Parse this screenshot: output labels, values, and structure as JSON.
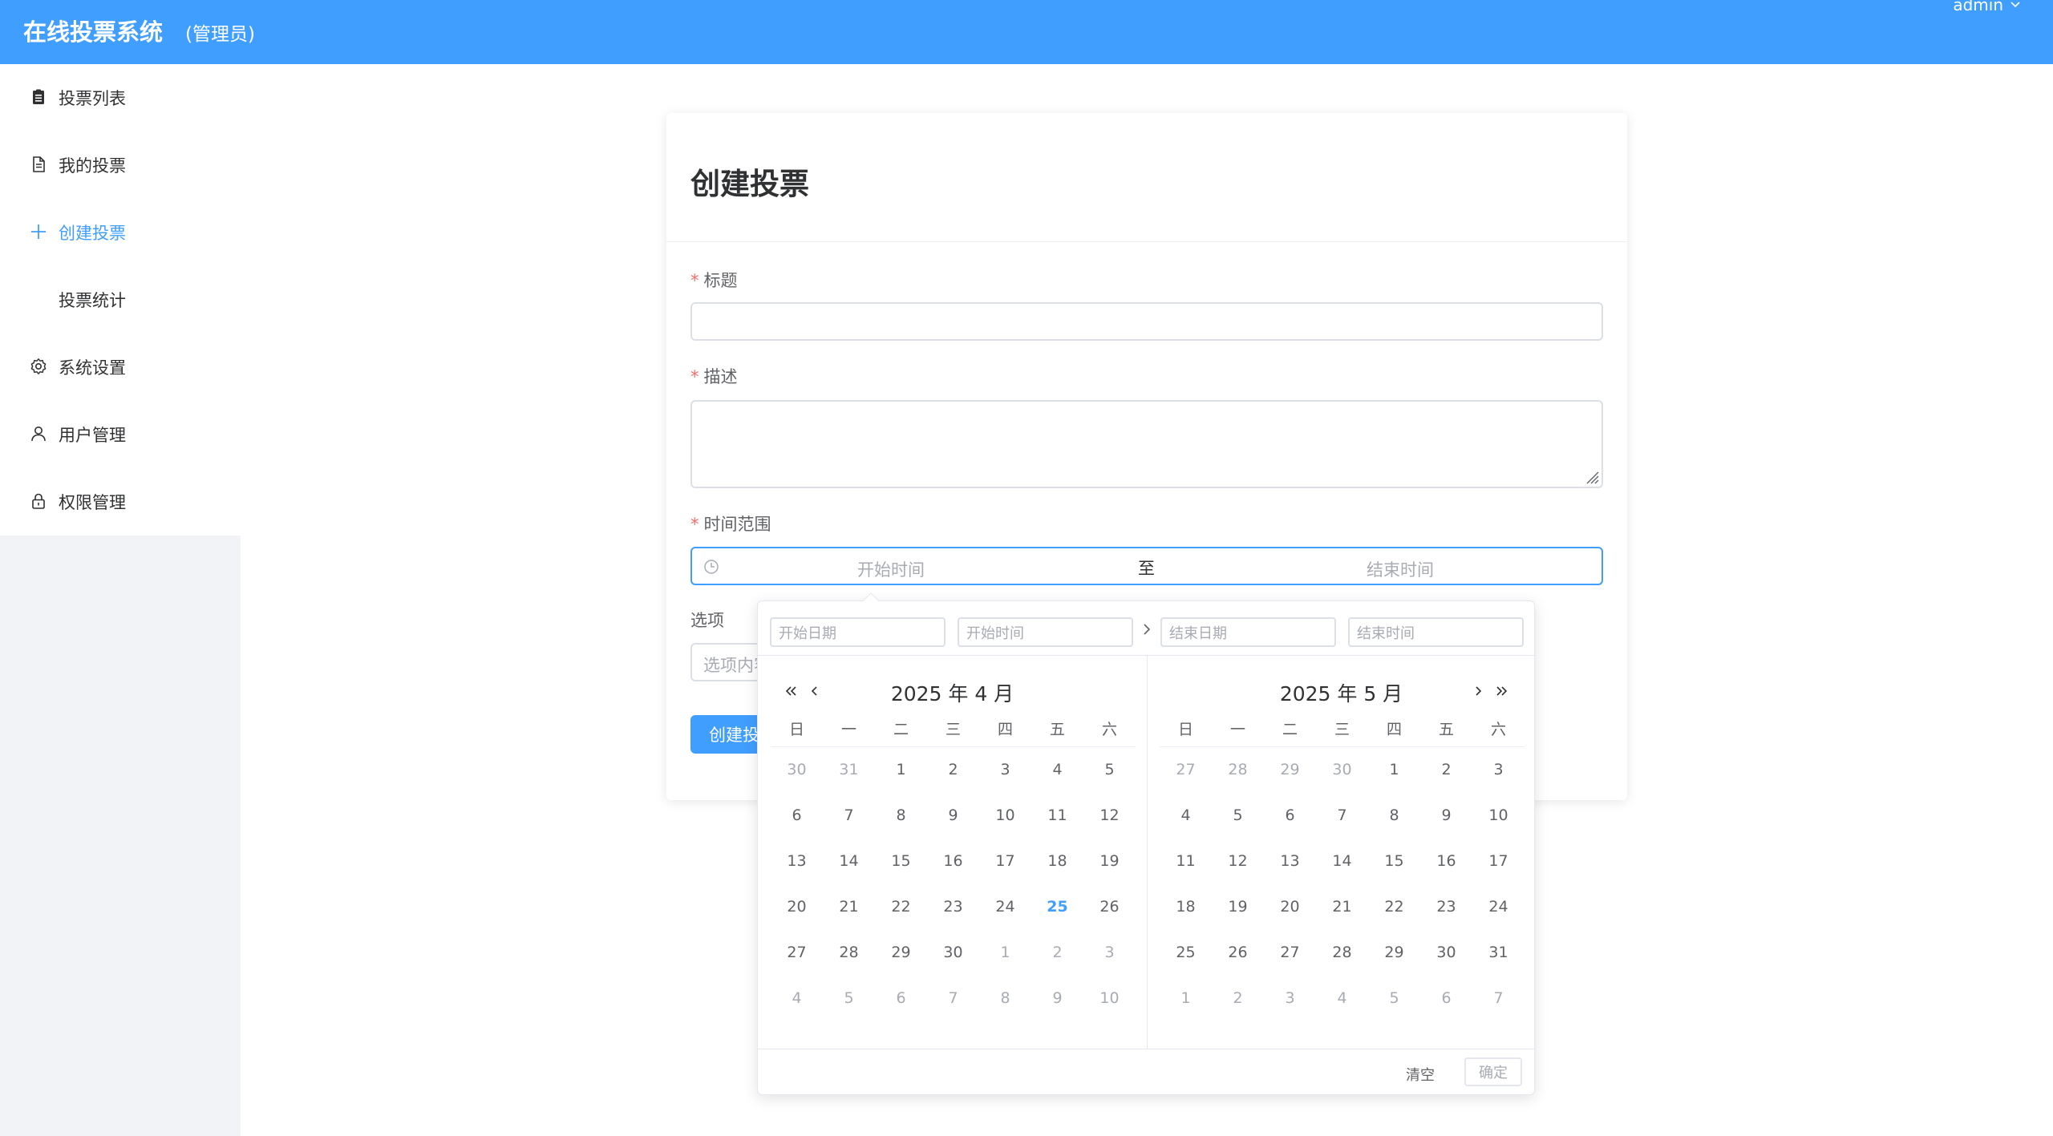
{
  "header": {
    "brand": "在线投票系统",
    "role": "(管理员)",
    "user": "admin",
    "bg_color": "#409eff"
  },
  "sidebar": {
    "items": [
      {
        "label": "投票列表",
        "icon": "clipboard-icon",
        "active": false
      },
      {
        "label": "我的投票",
        "icon": "document-icon",
        "active": false
      },
      {
        "label": "创建投票",
        "icon": "plus-icon",
        "active": true
      },
      {
        "label": "投票统计",
        "icon": "",
        "active": false
      },
      {
        "label": "系统设置",
        "icon": "gear-icon",
        "active": false
      },
      {
        "label": "用户管理",
        "icon": "user-icon",
        "active": false
      },
      {
        "label": "权限管理",
        "icon": "lock-icon",
        "active": false
      }
    ]
  },
  "form": {
    "title": "创建投票",
    "required_mark": "*",
    "title_label": "标题",
    "title_value": "",
    "desc_label": "描述",
    "desc_value": "",
    "range_label": "时间范围",
    "range_start_placeholder": "开始时间",
    "range_separator": "至",
    "range_end_placeholder": "结束时间",
    "options_label": "选项",
    "option_placeholder": "选项内容",
    "submit_label": "创建投票"
  },
  "picker": {
    "start_date_placeholder": "开始日期",
    "start_time_placeholder": "开始时间",
    "end_date_placeholder": "结束日期",
    "end_time_placeholder": "结束时间",
    "weekdays": [
      "日",
      "一",
      "二",
      "三",
      "四",
      "五",
      "六"
    ],
    "left": {
      "title": "2025 年 4 月",
      "weeks": [
        [
          {
            "d": "30",
            "o": true
          },
          {
            "d": "31",
            "o": true
          },
          {
            "d": "1"
          },
          {
            "d": "2"
          },
          {
            "d": "3"
          },
          {
            "d": "4"
          },
          {
            "d": "5"
          }
        ],
        [
          {
            "d": "6"
          },
          {
            "d": "7"
          },
          {
            "d": "8"
          },
          {
            "d": "9"
          },
          {
            "d": "10"
          },
          {
            "d": "11"
          },
          {
            "d": "12"
          }
        ],
        [
          {
            "d": "13"
          },
          {
            "d": "14"
          },
          {
            "d": "15"
          },
          {
            "d": "16"
          },
          {
            "d": "17"
          },
          {
            "d": "18"
          },
          {
            "d": "19"
          }
        ],
        [
          {
            "d": "20"
          },
          {
            "d": "21"
          },
          {
            "d": "22"
          },
          {
            "d": "23"
          },
          {
            "d": "24"
          },
          {
            "d": "25",
            "t": true
          },
          {
            "d": "26"
          }
        ],
        [
          {
            "d": "27"
          },
          {
            "d": "28"
          },
          {
            "d": "29"
          },
          {
            "d": "30"
          },
          {
            "d": "1",
            "o": true
          },
          {
            "d": "2",
            "o": true
          },
          {
            "d": "3",
            "o": true
          }
        ],
        [
          {
            "d": "4",
            "o": true
          },
          {
            "d": "5",
            "o": true
          },
          {
            "d": "6",
            "o": true
          },
          {
            "d": "7",
            "o": true
          },
          {
            "d": "8",
            "o": true
          },
          {
            "d": "9",
            "o": true
          },
          {
            "d": "10",
            "o": true
          }
        ]
      ]
    },
    "right": {
      "title": "2025 年 5 月",
      "weeks": [
        [
          {
            "d": "27",
            "o": true
          },
          {
            "d": "28",
            "o": true
          },
          {
            "d": "29",
            "o": true
          },
          {
            "d": "30",
            "o": true
          },
          {
            "d": "1"
          },
          {
            "d": "2"
          },
          {
            "d": "3"
          }
        ],
        [
          {
            "d": "4"
          },
          {
            "d": "5"
          },
          {
            "d": "6"
          },
          {
            "d": "7"
          },
          {
            "d": "8"
          },
          {
            "d": "9"
          },
          {
            "d": "10"
          }
        ],
        [
          {
            "d": "11"
          },
          {
            "d": "12"
          },
          {
            "d": "13"
          },
          {
            "d": "14"
          },
          {
            "d": "15"
          },
          {
            "d": "16"
          },
          {
            "d": "17"
          }
        ],
        [
          {
            "d": "18"
          },
          {
            "d": "19"
          },
          {
            "d": "20"
          },
          {
            "d": "21"
          },
          {
            "d": "22"
          },
          {
            "d": "23"
          },
          {
            "d": "24"
          }
        ],
        [
          {
            "d": "25"
          },
          {
            "d": "26"
          },
          {
            "d": "27"
          },
          {
            "d": "28"
          },
          {
            "d": "29"
          },
          {
            "d": "30"
          },
          {
            "d": "31"
          }
        ],
        [
          {
            "d": "1",
            "o": true
          },
          {
            "d": "2",
            "o": true
          },
          {
            "d": "3",
            "o": true
          },
          {
            "d": "4",
            "o": true
          },
          {
            "d": "5",
            "o": true
          },
          {
            "d": "6",
            "o": true
          },
          {
            "d": "7",
            "o": true
          }
        ]
      ]
    },
    "clear_label": "清空",
    "confirm_label": "确定",
    "accent_color": "#409eff"
  }
}
